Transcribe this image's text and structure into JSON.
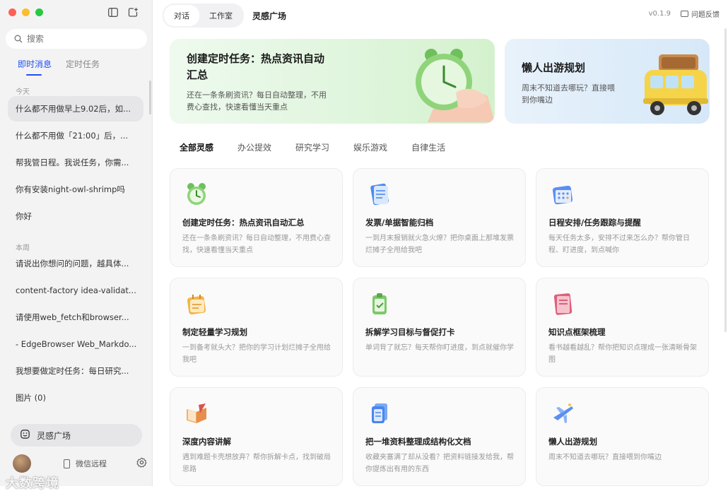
{
  "sidebar": {
    "search_placeholder": "搜索",
    "tabs": [
      {
        "label": "即时消息",
        "active": true
      },
      {
        "label": "定时任务",
        "active": false
      }
    ],
    "sections": [
      {
        "label": "今天",
        "items": [
          "什么都不用做早上9.02后，如...",
          "什么都不用做「21:00」后，...",
          "帮我管日程。我说任务，你需...",
          "你有安装night-owl-shrimp吗",
          "你好"
        ]
      },
      {
        "label": "本周",
        "items": [
          "请说出你想问的问题，越具体...",
          "content-factory idea-validat...",
          "请使用web_fetch和browser...",
          "- EdgeBrowser Web_Markdo...",
          "我想要做定时任务：每日研究...",
          "图片 (0)"
        ]
      }
    ],
    "inspire_button": "灵感广场",
    "wechat_remote": "微信远程",
    "watermark": "大数跨境"
  },
  "topbar": {
    "modes": [
      {
        "label": "对话",
        "active": true
      },
      {
        "label": "工作室",
        "active": false
      }
    ],
    "page_title": "灵感广场",
    "version": "v0.1.9",
    "feedback": "问题反馈"
  },
  "banners": [
    {
      "title_line1": "创建定时任务：热点资讯自动",
      "title_line2": "汇总",
      "desc_line1": "还在一条条刷资讯？每日自动整理，不用",
      "desc_line2": "费心查找，快速看懂当天重点"
    },
    {
      "title_line1": "懒人出游规划",
      "desc_line1": "周末不知道去哪玩？直接喂",
      "desc_line2": "到你嘴边"
    }
  ],
  "categories": [
    {
      "label": "全部灵感",
      "active": true
    },
    {
      "label": "办公提效",
      "active": false
    },
    {
      "label": "研究学习",
      "active": false
    },
    {
      "label": "娱乐游戏",
      "active": false
    },
    {
      "label": "自律生活",
      "active": false
    }
  ],
  "cards": [
    {
      "icon": "alarm-clock-icon",
      "title": "创建定时任务：热点资讯自动汇总",
      "desc": "还在一条条刷资讯？每日自动整理，不用费心查找，快速看懂当天重点"
    },
    {
      "icon": "invoice-icon",
      "title": "发票/单据智能归档",
      "desc": "一到月末报销就火急火燎？把你桌面上那堆发票烂摊子全甩给我吧"
    },
    {
      "icon": "calendar-icon",
      "title": "日程安排/任务跟踪与提醒",
      "desc": "每天任务太多，安排不过来怎么办？帮你管日程、盯进度，到点喊你"
    },
    {
      "icon": "plan-icon",
      "title": "制定轻量学习规划",
      "desc": "一到备考就头大？把你的学习计划烂摊子全甩给我吧"
    },
    {
      "icon": "checkin-icon",
      "title": "拆解学习目标与督促打卡",
      "desc": "单词背了就忘？每天帮你盯进度，到点就催你学"
    },
    {
      "icon": "notebook-icon",
      "title": "知识点框架梳理",
      "desc": "看书越看越乱？帮你把知识点理成一张清晰骨架图"
    },
    {
      "icon": "book-icon",
      "title": "深度内容讲解",
      "desc": "遇到难题卡壳想放弃？帮你拆解卡点，找到破局思路"
    },
    {
      "icon": "documents-icon",
      "title": "把一堆资料整理成结构化文档",
      "desc": "收藏夹塞满了却从没看？把资料链接发给我，帮你提炼出有用的东西"
    },
    {
      "icon": "airplane-icon",
      "title": "懒人出游规划",
      "desc": "周末不知道去哪玩？直接喂到你嘴边"
    }
  ]
}
